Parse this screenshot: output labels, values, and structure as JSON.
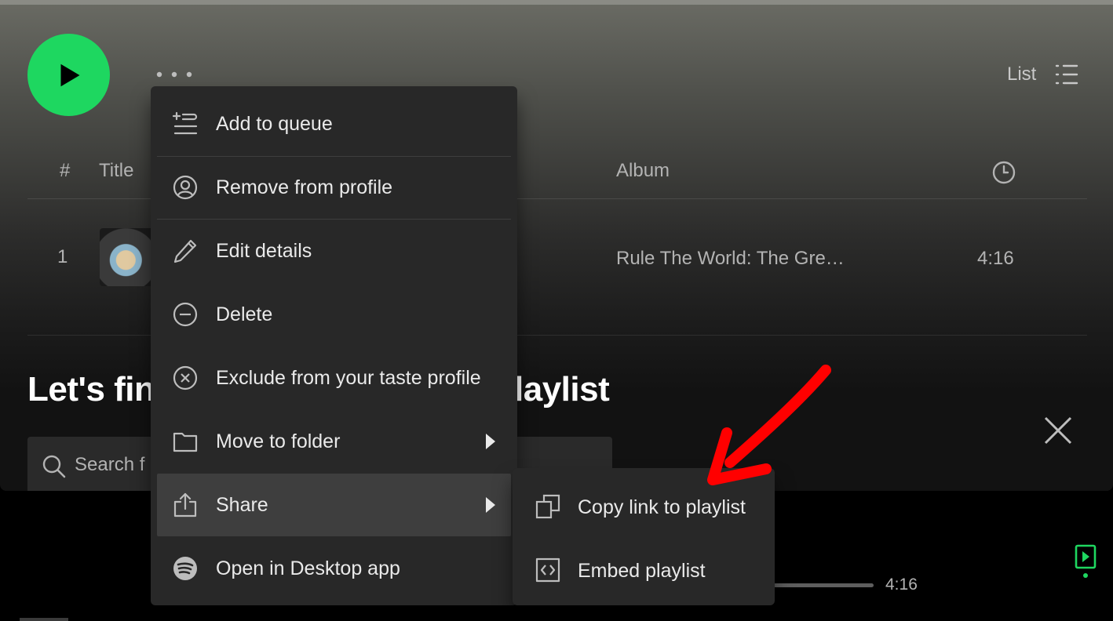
{
  "header": {
    "play_icon": "play-icon",
    "more_icon": "more-horizontal-icon",
    "view_toggle_label": "List",
    "view_toggle_icon": "list-icon"
  },
  "table": {
    "columns": [
      "#",
      "Title",
      "Album",
      "clock-icon"
    ],
    "rows": [
      {
        "index": "1",
        "album": "Rule The World: The Gre…",
        "duration": "4:16"
      }
    ]
  },
  "recommend": {
    "title_left": "Let's fin",
    "title_right": "laylist",
    "search_placeholder": "Search f",
    "close_icon": "close-icon"
  },
  "context_menu": {
    "items": [
      {
        "label": "Add to queue",
        "icon": "add-to-queue-icon"
      },
      {
        "label": "Remove from profile",
        "icon": "user-circle-icon"
      },
      {
        "label": "Edit details",
        "icon": "pencil-icon"
      },
      {
        "label": "Delete",
        "icon": "minus-circle-icon"
      },
      {
        "label": "Exclude from your taste profile",
        "icon": "x-circle-icon"
      },
      {
        "label": "Move to folder",
        "icon": "folder-icon",
        "has_submenu": true
      },
      {
        "label": "Share",
        "icon": "share-icon",
        "has_submenu": true,
        "active": true
      },
      {
        "label": "Open in Desktop app",
        "icon": "spotify-logo-icon"
      }
    ]
  },
  "share_submenu": {
    "items": [
      {
        "label": "Copy link to playlist",
        "icon": "copy-icon"
      },
      {
        "label": "Embed playlist",
        "icon": "embed-code-icon"
      }
    ]
  },
  "player": {
    "duration": "4:16",
    "now_playing_view_icon": "now-playing-view-icon"
  },
  "colors": {
    "accent_green": "#1ed760",
    "menu_bg": "#282828",
    "menu_hover": "#3e3e3e",
    "annotation_red": "#ff0000"
  }
}
